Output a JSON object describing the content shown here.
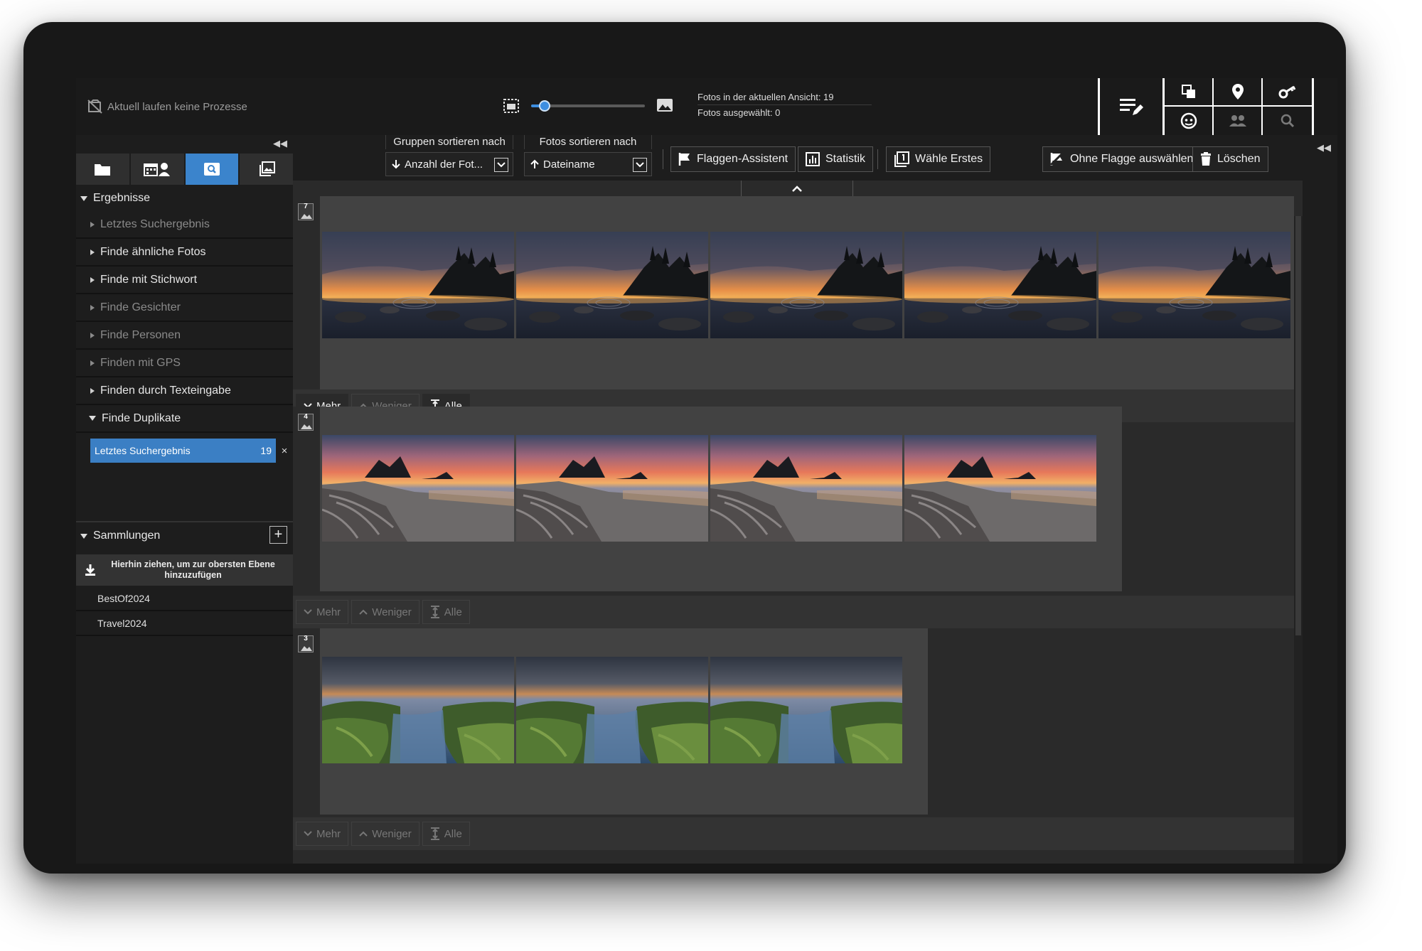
{
  "status": {
    "text": "Aktuell laufen keine Prozesse"
  },
  "zoom": {
    "value": 0.12
  },
  "info": {
    "photos_in_view": "Fotos in der aktuellen Ansicht: 19",
    "photos_selected": "Fotos ausgewählt: 0"
  },
  "sidebar": {
    "results_header": "Ergebnisse",
    "items": [
      {
        "label": "Letztes Suchergebnis",
        "enabled": false
      },
      {
        "label": "Finde ähnliche Fotos",
        "enabled": true
      },
      {
        "label": "Finde mit Stichwort",
        "enabled": true
      },
      {
        "label": "Finde Gesichter",
        "enabled": false
      },
      {
        "label": "Finde Personen",
        "enabled": false
      },
      {
        "label": "Finden mit GPS",
        "enabled": false
      },
      {
        "label": "Finden durch Texteingabe",
        "enabled": true
      },
      {
        "label": "Finde Duplikate",
        "enabled": true
      }
    ],
    "duplicates_sub": {
      "label": "Letztes Suchergebnis",
      "count": "19",
      "close": "×"
    },
    "collections_header": "Sammlungen",
    "add_label": "+",
    "drop_hint": "Hierhin ziehen, um zur obersten Ebene hinzuzufügen",
    "collections": [
      "BestOf2024",
      "Travel2024"
    ]
  },
  "toolbar": {
    "group_sort_title": "Gruppen sortieren nach",
    "group_sort_value": "Anzahl der Fot...",
    "photo_sort_title": "Fotos sortieren nach",
    "photo_sort_value": "Dateiname",
    "flag_assistant": "Flaggen-Assistent",
    "statistics": "Statistik",
    "choose_first": "Wähle Erstes",
    "select_unflagged": "Ohne Flagge auswählen",
    "delete": "Löschen"
  },
  "groups": [
    {
      "count": "7",
      "scene": "sunset-lake",
      "thumbs": 5,
      "buttons": {
        "more": "Mehr",
        "less": "Weniger",
        "all": "Alle"
      },
      "more_enabled": true
    },
    {
      "count": "4",
      "scene": "beach-dusk",
      "thumbs": 4,
      "buttons": {
        "more": "Mehr",
        "less": "Weniger",
        "all": "Alle"
      },
      "more_enabled": false
    },
    {
      "count": "3",
      "scene": "green-coast",
      "thumbs": 3,
      "buttons": {
        "more": "Mehr",
        "less": "Weniger",
        "all": "Alle"
      },
      "more_enabled": false
    }
  ],
  "colors": {
    "accent": "#3b84cc",
    "selected": "#3b7fc4"
  }
}
